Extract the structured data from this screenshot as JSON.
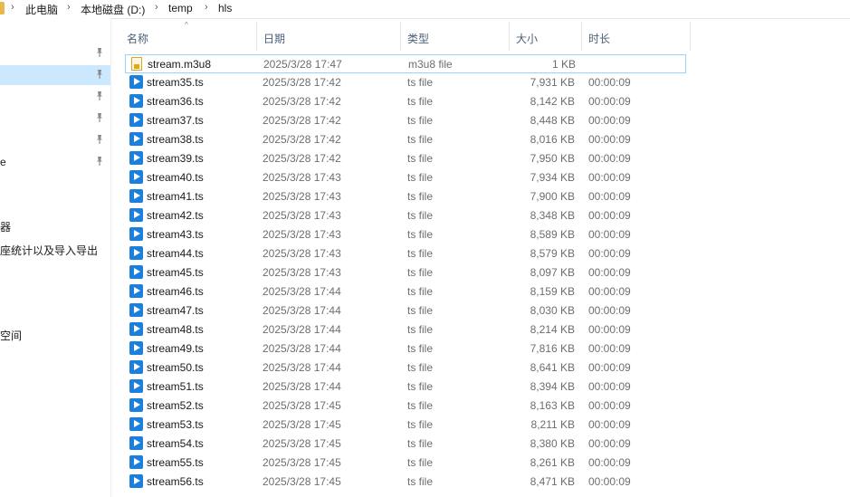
{
  "breadcrumb": {
    "items": [
      "此电脑",
      "本地磁盘 (D:)",
      "temp",
      "hls"
    ],
    "separator": "›"
  },
  "nav": {
    "items": [
      {
        "label": "",
        "pinned": true,
        "selected": false
      },
      {
        "label": "",
        "pinned": true,
        "selected": true
      },
      {
        "label": "",
        "pinned": true,
        "selected": false
      },
      {
        "label": "",
        "pinned": true,
        "selected": false
      },
      {
        "label": "",
        "pinned": true,
        "selected": false
      },
      {
        "label": "e",
        "pinned": true,
        "selected": false
      },
      {
        "label": "器",
        "pinned": false,
        "selected": false
      },
      {
        "label": "座统计以及导入导出",
        "pinned": false,
        "selected": false
      },
      {
        "label": "空间",
        "pinned": false,
        "selected": false
      }
    ]
  },
  "columns": {
    "name": "名称",
    "date": "日期",
    "type": "类型",
    "size": "大小",
    "duration": "时长"
  },
  "sort_indicator": "^",
  "files": [
    {
      "name": "stream.m3u8",
      "date": "2025/3/28 17:47",
      "type": "m3u8 file",
      "size": "1 KB",
      "duration": "",
      "icon": "m3u8-file-icon",
      "selected": true
    },
    {
      "name": "stream35.ts",
      "date": "2025/3/28 17:42",
      "type": "ts file",
      "size": "7,931 KB",
      "duration": "00:00:09",
      "icon": "video-file-icon"
    },
    {
      "name": "stream36.ts",
      "date": "2025/3/28 17:42",
      "type": "ts file",
      "size": "8,142 KB",
      "duration": "00:00:09",
      "icon": "video-file-icon"
    },
    {
      "name": "stream37.ts",
      "date": "2025/3/28 17:42",
      "type": "ts file",
      "size": "8,448 KB",
      "duration": "00:00:09",
      "icon": "video-file-icon"
    },
    {
      "name": "stream38.ts",
      "date": "2025/3/28 17:42",
      "type": "ts file",
      "size": "8,016 KB",
      "duration": "00:00:09",
      "icon": "video-file-icon"
    },
    {
      "name": "stream39.ts",
      "date": "2025/3/28 17:42",
      "type": "ts file",
      "size": "7,950 KB",
      "duration": "00:00:09",
      "icon": "video-file-icon"
    },
    {
      "name": "stream40.ts",
      "date": "2025/3/28 17:43",
      "type": "ts file",
      "size": "7,934 KB",
      "duration": "00:00:09",
      "icon": "video-file-icon"
    },
    {
      "name": "stream41.ts",
      "date": "2025/3/28 17:43",
      "type": "ts file",
      "size": "7,900 KB",
      "duration": "00:00:09",
      "icon": "video-file-icon"
    },
    {
      "name": "stream42.ts",
      "date": "2025/3/28 17:43",
      "type": "ts file",
      "size": "8,348 KB",
      "duration": "00:00:09",
      "icon": "video-file-icon"
    },
    {
      "name": "stream43.ts",
      "date": "2025/3/28 17:43",
      "type": "ts file",
      "size": "8,589 KB",
      "duration": "00:00:09",
      "icon": "video-file-icon"
    },
    {
      "name": "stream44.ts",
      "date": "2025/3/28 17:43",
      "type": "ts file",
      "size": "8,579 KB",
      "duration": "00:00:09",
      "icon": "video-file-icon"
    },
    {
      "name": "stream45.ts",
      "date": "2025/3/28 17:43",
      "type": "ts file",
      "size": "8,097 KB",
      "duration": "00:00:09",
      "icon": "video-file-icon"
    },
    {
      "name": "stream46.ts",
      "date": "2025/3/28 17:44",
      "type": "ts file",
      "size": "8,159 KB",
      "duration": "00:00:09",
      "icon": "video-file-icon"
    },
    {
      "name": "stream47.ts",
      "date": "2025/3/28 17:44",
      "type": "ts file",
      "size": "8,030 KB",
      "duration": "00:00:09",
      "icon": "video-file-icon"
    },
    {
      "name": "stream48.ts",
      "date": "2025/3/28 17:44",
      "type": "ts file",
      "size": "8,214 KB",
      "duration": "00:00:09",
      "icon": "video-file-icon"
    },
    {
      "name": "stream49.ts",
      "date": "2025/3/28 17:44",
      "type": "ts file",
      "size": "7,816 KB",
      "duration": "00:00:09",
      "icon": "video-file-icon"
    },
    {
      "name": "stream50.ts",
      "date": "2025/3/28 17:44",
      "type": "ts file",
      "size": "8,641 KB",
      "duration": "00:00:09",
      "icon": "video-file-icon"
    },
    {
      "name": "stream51.ts",
      "date": "2025/3/28 17:44",
      "type": "ts file",
      "size": "8,394 KB",
      "duration": "00:00:09",
      "icon": "video-file-icon"
    },
    {
      "name": "stream52.ts",
      "date": "2025/3/28 17:45",
      "type": "ts file",
      "size": "8,163 KB",
      "duration": "00:00:09",
      "icon": "video-file-icon"
    },
    {
      "name": "stream53.ts",
      "date": "2025/3/28 17:45",
      "type": "ts file",
      "size": "8,211 KB",
      "duration": "00:00:09",
      "icon": "video-file-icon"
    },
    {
      "name": "stream54.ts",
      "date": "2025/3/28 17:45",
      "type": "ts file",
      "size": "8,380 KB",
      "duration": "00:00:09",
      "icon": "video-file-icon"
    },
    {
      "name": "stream55.ts",
      "date": "2025/3/28 17:45",
      "type": "ts file",
      "size": "8,261 KB",
      "duration": "00:00:09",
      "icon": "video-file-icon"
    },
    {
      "name": "stream56.ts",
      "date": "2025/3/28 17:45",
      "type": "ts file",
      "size": "8,471 KB",
      "duration": "00:00:09",
      "icon": "video-file-icon"
    }
  ],
  "colors": {
    "selection_fill": "#cce8ff",
    "selection_border": "#99d1ff",
    "header_text": "#4c607a",
    "ts_icon": "#1c7fdb",
    "folder": "#e8b94a"
  }
}
